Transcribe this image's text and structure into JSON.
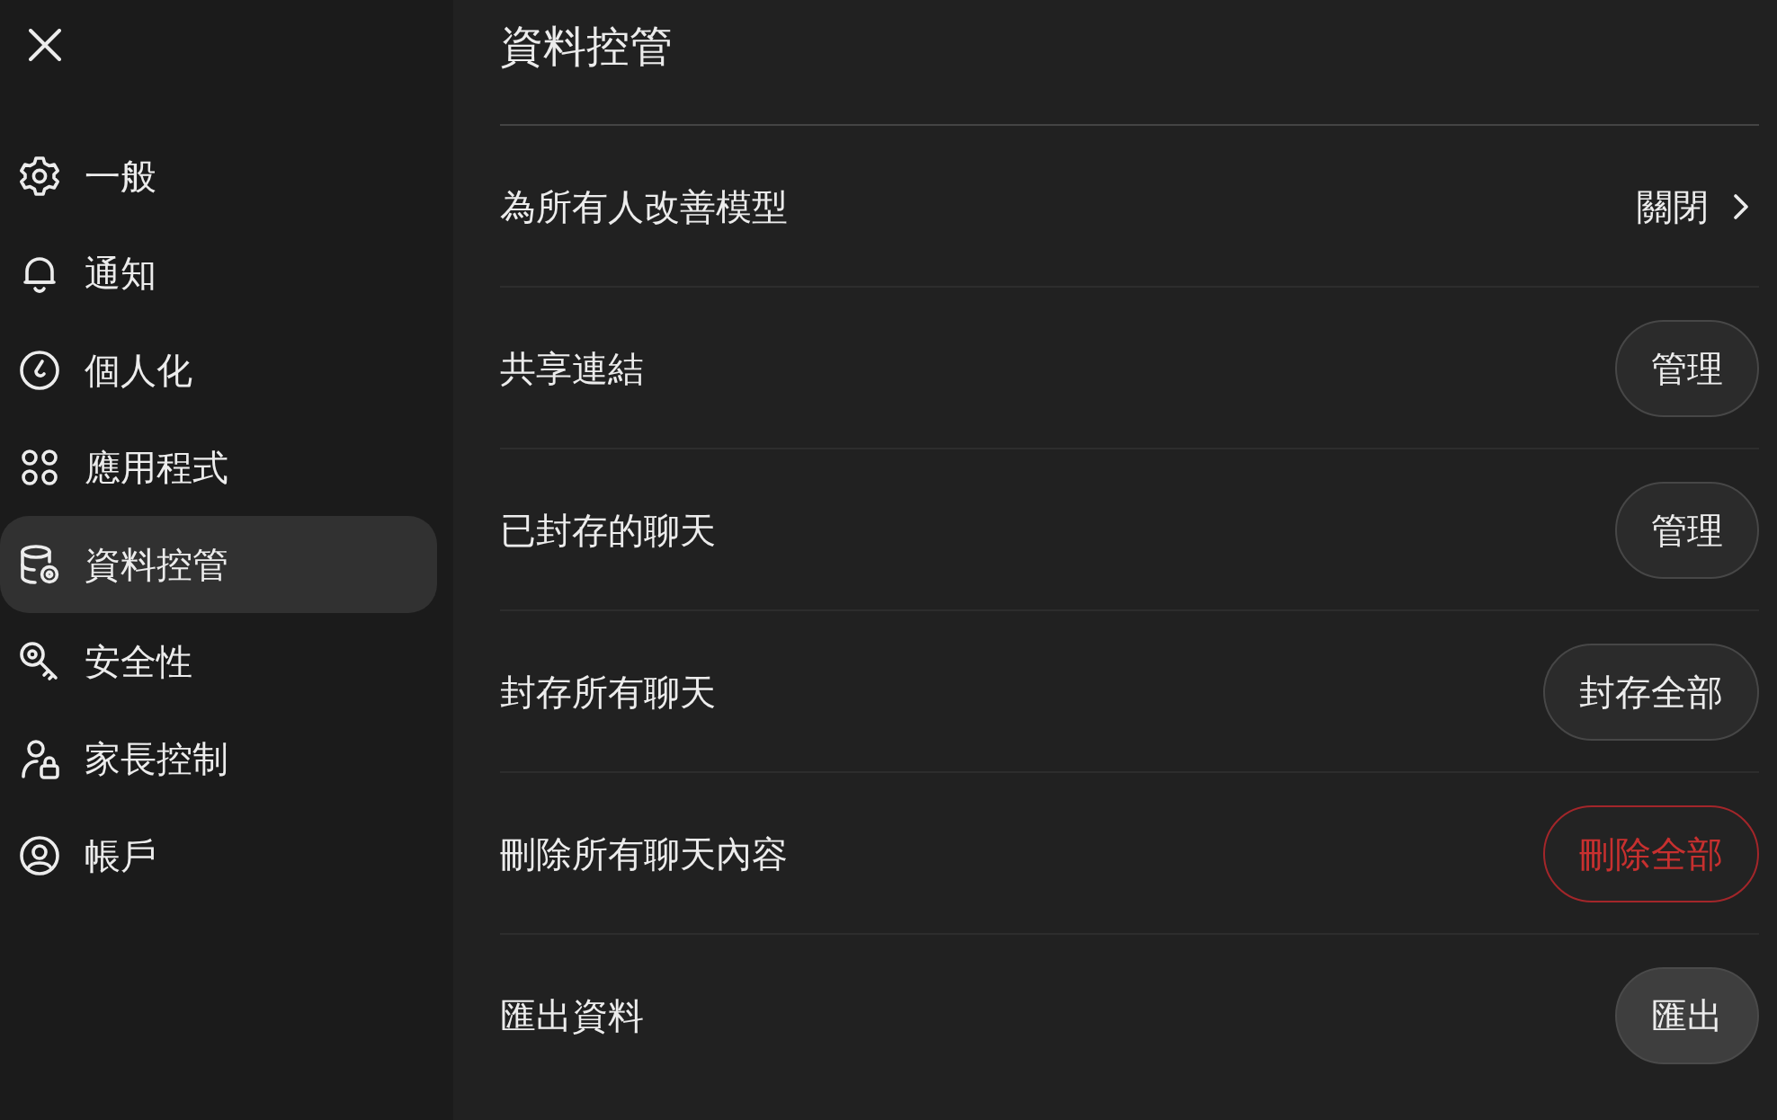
{
  "sidebar": {
    "items": [
      {
        "label": "一般",
        "selected": false
      },
      {
        "label": "通知",
        "selected": false
      },
      {
        "label": "個人化",
        "selected": false
      },
      {
        "label": "應用程式",
        "selected": false
      },
      {
        "label": "資料控管",
        "selected": true
      },
      {
        "label": "安全性",
        "selected": false
      },
      {
        "label": "家長控制",
        "selected": false
      },
      {
        "label": "帳戶",
        "selected": false
      }
    ]
  },
  "main": {
    "title": "資料控管",
    "rows": [
      {
        "label": "為所有人改善模型",
        "kind": "value",
        "value": "關閉"
      },
      {
        "label": "共享連結",
        "kind": "button",
        "button": {
          "label": "管理",
          "danger": false,
          "hovered": false
        }
      },
      {
        "label": "已封存的聊天",
        "kind": "button",
        "button": {
          "label": "管理",
          "danger": false,
          "hovered": false
        }
      },
      {
        "label": "封存所有聊天",
        "kind": "button",
        "button": {
          "label": "封存全部",
          "danger": false,
          "hovered": false
        }
      },
      {
        "label": "刪除所有聊天內容",
        "kind": "button",
        "button": {
          "label": "刪除全部",
          "danger": true,
          "hovered": false
        }
      },
      {
        "label": "匯出資料",
        "kind": "button",
        "button": {
          "label": "匯出",
          "danger": false,
          "hovered": true
        }
      }
    ]
  }
}
